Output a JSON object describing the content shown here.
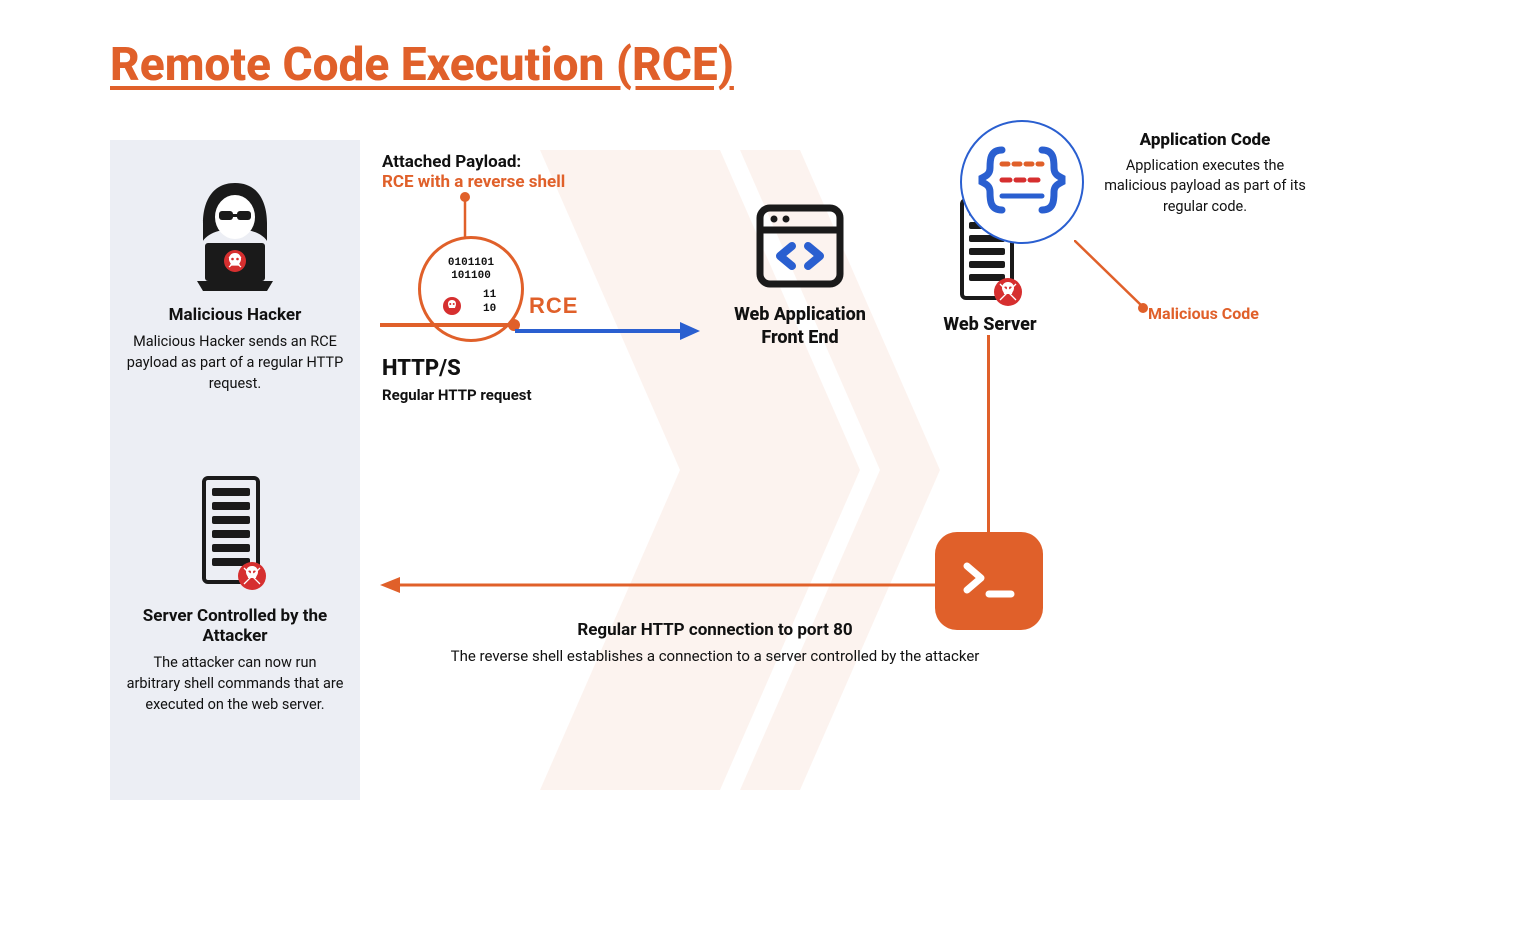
{
  "title": "Remote Code Execution (RCE)",
  "hacker": {
    "title": "Malicious Hacker",
    "desc": "Malicious Hacker sends an RCE payload as part of a regular HTTP request."
  },
  "attacker_server": {
    "title": "Server Controlled by the Attacker",
    "desc": "The attacker can now run arbitrary shell commands that are executed on the web server."
  },
  "payload": {
    "label": "Attached Payload:",
    "value": "RCE with a reverse shell"
  },
  "rce_circle": {
    "binary1": "0101101",
    "binary2": "101100",
    "binary3": "11",
    "binary4": "10",
    "label": "RCE"
  },
  "http": {
    "title": "HTTP/S",
    "sub": "Regular HTTP request"
  },
  "webapp": {
    "title_l1": "Web Application",
    "title_l2": "Front End"
  },
  "webserver": {
    "title": "Web Server"
  },
  "appcode": {
    "title": "Application Code",
    "desc": "Application executes the malicious payload as part of its regular code."
  },
  "malicious_code": "Malicious Code",
  "return": {
    "title": "Regular HTTP connection to port 80",
    "desc": "The reverse shell establishes a connection to a server controlled by the attacker"
  }
}
